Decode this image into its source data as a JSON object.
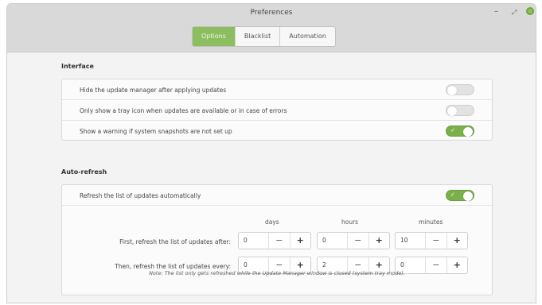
{
  "window": {
    "title": "Preferences",
    "controls": {
      "minimize": "–",
      "maximize": "⤢"
    }
  },
  "tabs": [
    {
      "label": "Options",
      "active": true
    },
    {
      "label": "Blacklist",
      "active": false
    },
    {
      "label": "Automation",
      "active": false
    }
  ],
  "interface": {
    "heading": "Interface",
    "rows": [
      {
        "label": "Hide the update manager after applying updates",
        "enabled": false
      },
      {
        "label": "Only show a tray icon when updates are available or in case of errors",
        "enabled": false
      },
      {
        "label": "Show a warning if system snapshots are not set up",
        "enabled": true
      }
    ]
  },
  "auto_refresh": {
    "heading": "Auto-refresh",
    "toggle_label": "Refresh the list of updates automatically",
    "toggle_enabled": true,
    "units": {
      "days": "days",
      "hours": "hours",
      "minutes": "minutes"
    },
    "first": {
      "label": "First, refresh the list of updates after:",
      "days": "0",
      "hours": "0",
      "minutes": "10"
    },
    "then": {
      "label": "Then, refresh the list of updates every:",
      "days": "0",
      "hours": "2",
      "minutes": "0"
    },
    "note": "Note: The list only gets refreshed while the Update Manager window is closed (system tray mode).",
    "spin_minus": "−",
    "spin_plus": "+"
  },
  "colors": {
    "accent": "#8cbd5e",
    "switch_on": "#79b04a",
    "switch_off": "#e2e2e2"
  }
}
